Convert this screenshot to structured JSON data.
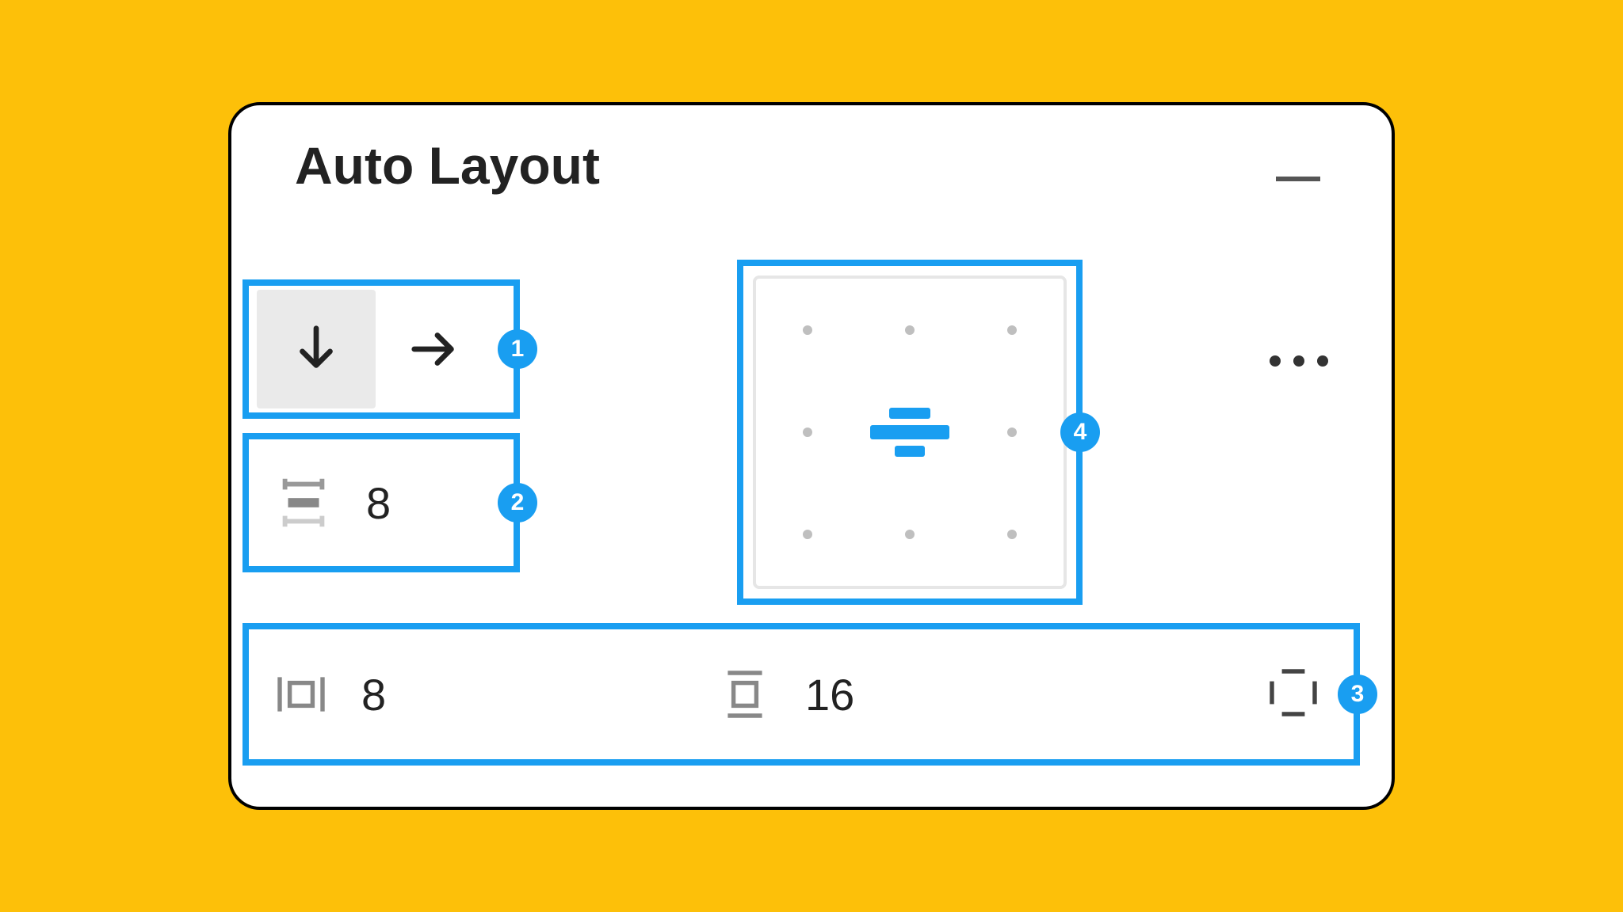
{
  "title": "Auto Layout",
  "callouts": {
    "direction": "1",
    "spacing": "2",
    "padding": "3",
    "alignment": "4"
  },
  "direction": {
    "vertical_selected": true,
    "options": [
      "vertical",
      "horizontal"
    ]
  },
  "spacing_value": "8",
  "padding": {
    "horizontal": "8",
    "vertical": "16"
  },
  "alignment": "center-center",
  "colors": {
    "highlight": "#199ef1",
    "background": "#fdc009"
  }
}
